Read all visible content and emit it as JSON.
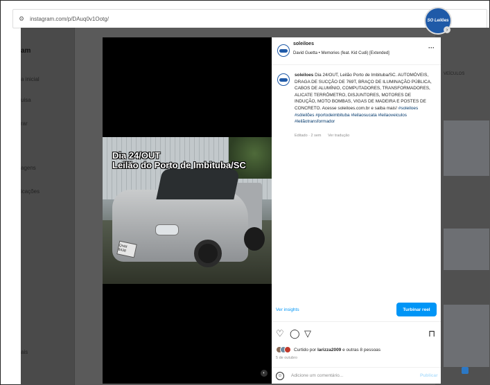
{
  "browser": {
    "url": "instagram.com/p/DAuq0v1Ootg/"
  },
  "sidebar": {
    "logo_fragment": "am",
    "items": [
      {
        "label": "a inicial",
        "icon": "home-icon"
      },
      {
        "label": "uisa",
        "icon": "search-icon"
      },
      {
        "label": "rar",
        "icon": "explore-icon"
      },
      {
        "label": "agens",
        "icon": "messages-icon"
      },
      {
        "label": "icações",
        "icon": "notifications-icon"
      },
      {
        "label": "ais",
        "icon": "more-icon"
      }
    ]
  },
  "background_right": {
    "veiculos_label": "VEÍCULOS",
    "logo_text": "SO Leilões"
  },
  "post": {
    "overlay_line1": "Dia 24/OUT",
    "overlay_line2": "Leilão do Porto de Imbituba/SC",
    "plate": "QHM 8438",
    "username": "soleiloes",
    "song": "David Guetta • Memories (feat. Kid Cudi) [Extended]",
    "caption_user": "soleiloes",
    "caption_text": "Dia 24/OUT, Leilão Porto de Imbituba/SC. AUTOMÓVEIS, DRAGA DE SUCÇÃO DE 769T, BRAÇO DE ILUMINAÇÃO PÚBLICA, CABOS DE ALUMÍNIO, COMPUTADORES, TRANSFORMADORES, ALICATE TERRÔMETRO, DISJUNTORES, MOTORES DE INDUÇÃO, MOTO BOMBAS, VIGAS DE MADEIRA E POSTES DE CONCRETO. Acesse soleiloes.com.br e saiba mais!",
    "caption_tags": "#soleiloes #sóleilões #portodeimbituba #leilaosucata #leilaoveiculos #leilãotransformador",
    "edited": "Editado · 2 sem",
    "see_translation": "Ver tradução",
    "insights": "Ver insights",
    "boost": "Turbinar reel",
    "liked_prefix": "Curtido por",
    "liked_user": "larizza2009",
    "liked_suffix": "e outras 8 pessoas",
    "date": "5 de outubro",
    "comment_placeholder": "Adicione um comentário...",
    "publish": "Publicar"
  },
  "colors": {
    "accent": "#0095f6",
    "brand": "#1f5aa8",
    "overlay_bg": "#5a5a5a"
  }
}
